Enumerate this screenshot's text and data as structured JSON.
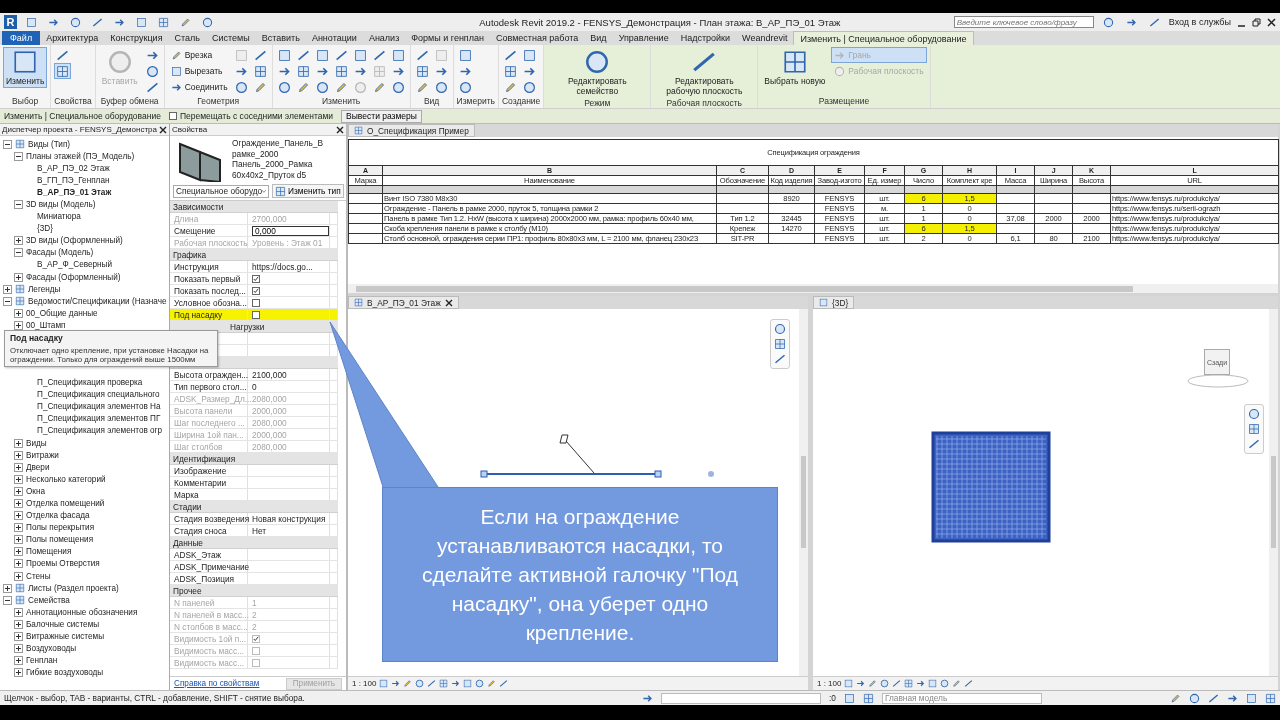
{
  "title_bar": {
    "logo": "R",
    "title": "Autodesk Revit 2019.2 - FENSYS_Демонстрация - План этажа: В_АР_ПЭ_01 Этаж",
    "search": {
      "placeholder": "Введите ключевое слово/фразу"
    },
    "sign_in": "Вход в службы"
  },
  "tabs": [
    {
      "label": "Файл",
      "kind": "file",
      "selected": false
    },
    {
      "label": "Архитектура",
      "kind": "tab",
      "selected": false
    },
    {
      "label": "Конструкция",
      "kind": "tab",
      "selected": false
    },
    {
      "label": "Сталь",
      "kind": "tab",
      "selected": false
    },
    {
      "label": "Системы",
      "kind": "tab",
      "selected": false
    },
    {
      "label": "Вставить",
      "kind": "tab",
      "selected": false
    },
    {
      "label": "Аннотации",
      "kind": "tab",
      "selected": false
    },
    {
      "label": "Анализ",
      "kind": "tab",
      "selected": false
    },
    {
      "label": "Формы и генплан",
      "kind": "tab",
      "selected": false
    },
    {
      "label": "Совместная работа",
      "kind": "tab",
      "selected": false
    },
    {
      "label": "Вид",
      "kind": "tab",
      "selected": false
    },
    {
      "label": "Управление",
      "kind": "tab",
      "selected": false
    },
    {
      "label": "Надстройки",
      "kind": "tab",
      "selected": false
    },
    {
      "label": "Weandrevit",
      "kind": "tab",
      "selected": false
    },
    {
      "label": "Изменить | Специальное оборудование",
      "kind": "contextual",
      "selected": true
    }
  ],
  "ribbon": [
    {
      "title": "Выбор",
      "contextual": false,
      "buttons": [
        {
          "kind": "big",
          "label": "Изменить",
          "disabled": false,
          "selected": true
        }
      ]
    },
    {
      "title": "Свойства",
      "contextual": false,
      "buttons": [
        {
          "kind": "icon",
          "disabled": false,
          "selected": false
        },
        {
          "kind": "icon",
          "disabled": false,
          "selected": true
        }
      ]
    },
    {
      "title": "Буфер обмена",
      "contextual": false,
      "buttons": [
        {
          "kind": "big",
          "label": "Вставить",
          "disabled": true,
          "selected": false
        },
        {
          "kind": "icon",
          "disabled": false,
          "selected": false
        },
        {
          "kind": "icon",
          "disabled": false,
          "selected": false
        },
        {
          "kind": "icon",
          "disabled": false,
          "selected": false
        }
      ]
    },
    {
      "title": "Геометрия",
      "contextual": false,
      "buttons": [
        {
          "kind": "small",
          "label": "Врезка",
          "disabled": false,
          "selected": false
        },
        {
          "kind": "small",
          "label": "Вырезать",
          "disabled": false,
          "selected": false
        },
        {
          "kind": "small",
          "label": "Соединить",
          "disabled": false,
          "selected": false
        },
        {
          "kind": "icon",
          "disabled": true,
          "selected": false
        },
        {
          "kind": "icon",
          "disabled": false,
          "selected": false
        },
        {
          "kind": "icon",
          "disabled": false,
          "selected": false
        },
        {
          "kind": "icon",
          "disabled": false,
          "selected": false
        },
        {
          "kind": "icon",
          "disabled": false,
          "selected": false
        },
        {
          "kind": "icon",
          "disabled": false,
          "selected": false
        }
      ]
    },
    {
      "title": "Изменить",
      "contextual": false,
      "buttons": [
        {
          "kind": "icon",
          "disabled": false,
          "selected": false
        },
        {
          "kind": "icon",
          "disabled": false,
          "selected": false
        },
        {
          "kind": "icon",
          "disabled": false,
          "selected": false
        },
        {
          "kind": "icon",
          "disabled": false,
          "selected": false
        },
        {
          "kind": "icon",
          "disabled": false,
          "selected": false
        },
        {
          "kind": "icon",
          "disabled": false,
          "selected": false
        },
        {
          "kind": "icon",
          "disabled": false,
          "selected": false
        },
        {
          "kind": "icon",
          "disabled": false,
          "selected": false
        },
        {
          "kind": "icon",
          "disabled": false,
          "selected": false
        },
        {
          "kind": "icon",
          "disabled": false,
          "selected": false
        },
        {
          "kind": "icon",
          "disabled": false,
          "selected": false
        },
        {
          "kind": "icon",
          "disabled": false,
          "selected": false
        },
        {
          "kind": "icon",
          "disabled": false,
          "selected": false
        },
        {
          "kind": "icon",
          "disabled": false,
          "selected": false
        },
        {
          "kind": "icon",
          "disabled": true,
          "selected": false
        },
        {
          "kind": "icon",
          "disabled": false,
          "selected": false
        },
        {
          "kind": "icon",
          "disabled": true,
          "selected": false
        },
        {
          "kind": "icon",
          "disabled": false,
          "selected": false
        },
        {
          "kind": "icon",
          "disabled": false,
          "selected": false
        },
        {
          "kind": "icon",
          "disabled": false,
          "selected": false
        },
        {
          "kind": "icon",
          "disabled": false,
          "selected": false
        }
      ]
    },
    {
      "title": "Вид",
      "contextual": false,
      "buttons": [
        {
          "kind": "icon",
          "disabled": false,
          "selected": false
        },
        {
          "kind": "icon",
          "disabled": false,
          "selected": false
        },
        {
          "kind": "icon",
          "disabled": false,
          "selected": false
        },
        {
          "kind": "icon",
          "disabled": true,
          "selected": false
        },
        {
          "kind": "icon",
          "disabled": false,
          "selected": false
        },
        {
          "kind": "icon",
          "disabled": false,
          "selected": false
        }
      ]
    },
    {
      "title": "Измерить",
      "contextual": false,
      "buttons": [
        {
          "kind": "icon",
          "disabled": false,
          "selected": false
        },
        {
          "kind": "icon",
          "disabled": false,
          "selected": false
        },
        {
          "kind": "icon",
          "disabled": false,
          "selected": false
        }
      ]
    },
    {
      "title": "Создание",
      "contextual": false,
      "buttons": [
        {
          "kind": "icon",
          "disabled": false,
          "selected": false
        },
        {
          "kind": "icon",
          "disabled": false,
          "selected": false
        },
        {
          "kind": "icon",
          "disabled": false,
          "selected": false
        },
        {
          "kind": "icon",
          "disabled": false,
          "selected": false
        },
        {
          "kind": "icon",
          "disabled": false,
          "selected": false
        },
        {
          "kind": "icon",
          "disabled": false,
          "selected": false
        }
      ]
    },
    {
      "title": "Режим",
      "contextual": true,
      "buttons": [
        {
          "kind": "big",
          "label": "Редактировать семейство",
          "disabled": false,
          "selected": false
        }
      ]
    },
    {
      "title": "Рабочая плоскость",
      "contextual": true,
      "buttons": [
        {
          "kind": "big",
          "label": "Редактировать рабочую плоскость",
          "disabled": false,
          "selected": false
        }
      ]
    },
    {
      "title": "Размещение",
      "contextual": true,
      "buttons": [
        {
          "kind": "big",
          "label": "Выбрать новую",
          "disabled": false,
          "selected": false
        },
        {
          "kind": "small",
          "label": "Грань",
          "disabled": true,
          "selected": true
        },
        {
          "kind": "small",
          "label": "Рабочая плоскость",
          "disabled": true,
          "selected": false
        }
      ]
    }
  ],
  "options_bar": {
    "context": "Изменить | Специальное оборудование",
    "move_option": {
      "label": "Перемещать с соседними элементами",
      "checked": false
    },
    "button": "Вывести размеры"
  },
  "project_browser": {
    "title": "Диспетчер проекта - FENSYS_Демонстра",
    "tree": [
      {
        "label": "Виды (Тип)",
        "expanded": true,
        "children": [
          {
            "label": "Планы этажей (ПЭ_Модель)",
            "expanded": true,
            "children": [
              {
                "label": "В_АР_ПЭ_02 Этаж",
                "active": false
              },
              {
                "label": "В_ГП_ПЭ_Генплан",
                "active": false
              },
              {
                "label": "В_АР_ПЭ_01 Этаж",
                "active": true
              }
            ]
          },
          {
            "label": "3D виды (Модель)",
            "expanded": true,
            "children": [
              {
                "label": "Миниатюра",
                "active": false
              },
              {
                "label": "{3D}",
                "active": false
              }
            ]
          },
          {
            "label": "3D виды (Оформленный)",
            "expanded": false
          },
          {
            "label": "Фасады (Модель)",
            "expanded": true,
            "children": [
              {
                "label": "В_АР_Ф_Северный",
                "active": false
              }
            ]
          },
          {
            "label": "Фасады (Оформленный)",
            "expanded": false
          }
        ]
      },
      {
        "label": "Легенды",
        "expanded": false
      },
      {
        "label": "Ведомости/Спецификации (Назначе",
        "expanded": true,
        "children": [
          {
            "label": "00_Общие данные",
            "expanded": false
          },
          {
            "label": "00_Штамп",
            "expanded": false
          }
        ]
      }
    ],
    "tooltip": {
      "title": "Под насадку",
      "text": "Отключает одно крепление, при установке Насадки на ограждении. Только для ограждений выше 1500мм"
    },
    "tree_continued": [
      {
        "children": [
          {
            "children": [
              {
                "label": "П_Спецификация проверка",
                "active": false
              },
              {
                "label": "П_Спецификация специального",
                "active": false
              },
              {
                "label": "П_Спецификация элементов На",
                "active": false
              },
              {
                "label": "П_Спецификация элементов ПГ",
                "active": false
              },
              {
                "label": "П_Спецификация элементов огр",
                "active": false
              }
            ]
          },
          {
            "label": "Виды",
            "expanded": false
          },
          {
            "label": "Витражи",
            "expanded": false
          },
          {
            "label": "Двери",
            "expanded": false
          },
          {
            "label": "Несколько категорий",
            "expanded": false
          },
          {
            "label": "Окна",
            "expanded": false
          },
          {
            "label": "Отделка помещений",
            "expanded": false
          },
          {
            "label": "Отделка фасада",
            "expanded": false
          },
          {
            "label": "Полы перекрытия",
            "expanded": false
          },
          {
            "label": "Полы помещения",
            "expanded": false
          },
          {
            "label": "Помещения",
            "expanded": false
          },
          {
            "label": "Проемы Отверстия",
            "expanded": false
          },
          {
            "label": "Стены",
            "expanded": false
          }
        ]
      },
      {
        "label": "Листы (Раздел проекта)",
        "expanded": false
      },
      {
        "label": "Семейства",
        "expanded": true,
        "children": [
          {
            "label": "Аннотационные обозначения",
            "expanded": false
          },
          {
            "label": "Балочные системы",
            "expanded": false
          },
          {
            "label": "Витражные системы",
            "expanded": false
          },
          {
            "label": "Воздуховоды",
            "expanded": false
          },
          {
            "label": "Генплан",
            "expanded": false
          },
          {
            "label": "Гибкие воздуховоды",
            "expanded": false
          }
        ]
      }
    ]
  },
  "properties": {
    "title": "Свойства",
    "type_name": "Ограждение_Панель_В рамке_2000 Панель_2000_Рамка 60x40x2_Пруток d5",
    "category": "Специальное оборудо",
    "edit_type": "Изменить тип",
    "groups": [
      {
        "title": "Зависимости",
        "covered": false,
        "rows": [
          {
            "label": "Длина",
            "value": "2700,000",
            "kind": "text",
            "disabled": true
          },
          {
            "label": "Смещение",
            "value": "0,000",
            "kind": "input",
            "disabled": false
          },
          {
            "label": "Рабочая плоскость",
            "value": "Уровень : Этаж 01",
            "kind": "text",
            "disabled": true
          }
        ]
      },
      {
        "title": "Графика",
        "covered": false,
        "rows": [
          {
            "label": "Инструкция",
            "value": "https://docs.go...",
            "kind": "text",
            "disabled": false,
            "selected": false
          },
          {
            "label": "Показать первый",
            "kind": "checkbox",
            "checked": true,
            "disabled": false,
            "selected": false
          },
          {
            "label": "Показать послед...",
            "kind": "checkbox",
            "checked": true,
            "disabled": false,
            "selected": false
          },
          {
            "label": "Условное обозна...",
            "kind": "checkbox",
            "checked": false,
            "disabled": false,
            "selected": false
          },
          {
            "label": "Под насадку",
            "kind": "checkbox",
            "checked": false,
            "disabled": false,
            "selected": true
          }
        ]
      },
      {
        "title": "Нагрузки",
        "covered": true,
        "rows": [
          {
            "kind": "text"
          },
          {
            "kind": "text"
          }
        ]
      },
      {
        "covered": true,
        "rows": [
          {
            "label": "Высота огражден...",
            "value": "2100,000",
            "kind": "text",
            "disabled": false
          },
          {
            "label": "Тип первого стол...",
            "value": "0",
            "kind": "text",
            "disabled": false
          },
          {
            "label": "ADSK_Размер_Дл...",
            "value": "2080,000",
            "kind": "text",
            "disabled": true
          },
          {
            "label": "Высота панели",
            "value": "2000,000",
            "kind": "text",
            "disabled": true
          },
          {
            "label": "Шаг последнего ...",
            "value": "2080,000",
            "kind": "text",
            "disabled": true
          },
          {
            "label": "Ширина 1ой пан...",
            "value": "2000,000",
            "kind": "text",
            "disabled": true
          },
          {
            "label": "Шаг столбов",
            "value": "2080,000",
            "kind": "text",
            "disabled": true
          }
        ]
      },
      {
        "title": "Идентификация",
        "covered": false,
        "rows": [
          {
            "label": "Изображение",
            "kind": "text",
            "disabled": false
          },
          {
            "label": "Комментарии",
            "kind": "text",
            "disabled": false
          },
          {
            "label": "Марка",
            "kind": "text",
            "disabled": false
          }
        ]
      },
      {
        "title": "Стадии",
        "covered": false,
        "rows": [
          {
            "label": "Стадия возведения",
            "value": "Новая конструкция",
            "kind": "text",
            "disabled": false
          },
          {
            "label": "Стадия сноса",
            "value": "Нет",
            "kind": "text",
            "disabled": false
          }
        ]
      },
      {
        "title": "Данные",
        "covered": false,
        "rows": [
          {
            "label": "ADSK_Этаж",
            "kind": "text",
            "disabled": false
          },
          {
            "label": "ADSK_Примечание",
            "kind": "text",
            "disabled": false
          },
          {
            "label": "ADSK_Позиция",
            "kind": "text",
            "disabled": false
          }
        ]
      },
      {
        "title": "Прочее",
        "covered": false,
        "rows": [
          {
            "label": "N панелей",
            "value": "1",
            "kind": "text",
            "disabled": true
          },
          {
            "label": "N панелей в масс...",
            "value": "2",
            "kind": "text",
            "disabled": true
          },
          {
            "label": "N столбов в масс...",
            "value": "2",
            "kind": "text",
            "disabled": true
          },
          {
            "label": "Видимость 1ой п...",
            "kind": "checkbox",
            "checked": true,
            "disabled": true
          },
          {
            "label": "Видимость масс...",
            "kind": "checkbox",
            "checked": false,
            "disabled": true
          },
          {
            "label": "Видимость масс...",
            "kind": "checkbox",
            "checked": false,
            "disabled": true
          }
        ]
      }
    ],
    "help_link": "Справка по свойствам",
    "apply": "Применить"
  },
  "schedule": {
    "tab": "О_Спецификация Пример",
    "title": "Спецификация ограждения",
    "columns": [
      {
        "letter": "A",
        "header": "Марка"
      },
      {
        "letter": "B",
        "header": "Наименование"
      },
      {
        "letter": "C",
        "header": "Обозначение"
      },
      {
        "letter": "D",
        "header": "Код изделия"
      },
      {
        "letter": "E",
        "header": "Завод-изгото"
      },
      {
        "letter": "F",
        "header": "Ед. измер"
      },
      {
        "letter": "G",
        "header": "Число"
      },
      {
        "letter": "H",
        "header": "Комплект кре"
      },
      {
        "letter": "I",
        "header": "Масса"
      },
      {
        "letter": "J",
        "header": "Ширина"
      },
      {
        "letter": "K",
        "header": "Высота"
      },
      {
        "letter": "L",
        "header": "URL"
      }
    ],
    "rows": [
      {
        "cells": [
          null,
          "Винт ISO 7380 M8x30",
          null,
          "8920",
          "FENSYS",
          "шт.",
          {
            "text": "6",
            "highlight": true
          },
          {
            "text": "1,5",
            "highlight": true
          },
          null,
          null,
          null,
          "https://www.fensys.ru/produkciya/"
        ]
      },
      {
        "cells": [
          null,
          "Ограждение - Панель в рамке 2000, пруток 5, толщина рамки 2",
          null,
          null,
          "FENSYS",
          "м.",
          "1",
          "0",
          null,
          null,
          null,
          "https://www.fensys.ru/serii-ograzh"
        ]
      },
      {
        "cells": [
          null,
          "Панель в рамке Тип 1.2. HxW (высота x ширина) 2000x2000 мм, рамка: профиль 60x40 мм,",
          "Тип 1.2",
          "32445",
          "FENSYS",
          "шт.",
          "1",
          "0",
          "37,08",
          "2000",
          "2000",
          "https://www.fensys.ru/produkciya/"
        ]
      },
      {
        "cells": [
          null,
          "Скоба крепления панели в рамке к столбу (M10)",
          "Крепеж",
          "14270",
          "FENSYS",
          "шт.",
          {
            "text": "6",
            "highlight": true
          },
          {
            "text": "1,5",
            "highlight": true
          },
          null,
          null,
          null,
          "https://www.fensys.ru/produkciya/"
        ]
      },
      {
        "cells": [
          null,
          "Столб основной, ограждения серии ПР1: профиль 80x80x3 мм, L = 2100 мм, фланец 230x23",
          "SIT-PR",
          null,
          "FENSYS",
          "шт.",
          "2",
          "0",
          "6,1",
          "80",
          "2100",
          "https://www.fensys.ru/produkciya/"
        ]
      }
    ]
  },
  "views": [
    {
      "kind": "plan",
      "tab": "В_АР_ПЭ_01 Этаж",
      "scale": "1 : 100"
    },
    {
      "kind": "model",
      "tab": "{3D}",
      "scale": "1 : 100",
      "view_cube": "Сзади"
    }
  ],
  "callout": {
    "text": "Если на ограждение устанавливаются насадки, то сделайте активной галочку \"Под насадку\", она уберет одно крепление."
  },
  "status_bar": {
    "hint": "Щелчок - выбор, TAB - варианты, CTRL - добавление, SHIFT - снятие выбора.",
    "count": ":0",
    "model": "Главная модель"
  }
}
